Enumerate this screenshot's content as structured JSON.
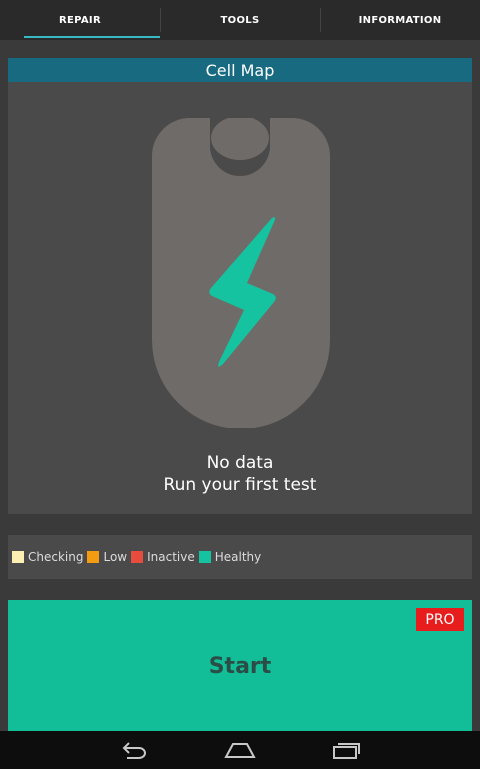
{
  "tabs": [
    {
      "label": "REPAIR",
      "active": true
    },
    {
      "label": "TOOLS",
      "active": false
    },
    {
      "label": "INFORMATION",
      "active": false
    }
  ],
  "cell_map": {
    "title": "Cell Map",
    "empty_line1": "No data",
    "empty_line2": "Run your first test",
    "icon": "battery-bolt-icon"
  },
  "legend": [
    {
      "label": "Checking",
      "color": "#fbefb2"
    },
    {
      "label": "Low",
      "color": "#f39c12"
    },
    {
      "label": "Inactive",
      "color": "#e74c3c"
    },
    {
      "label": "Healthy",
      "color": "#16c3a0"
    }
  ],
  "start_button": {
    "label": "Start",
    "badge": "PRO",
    "color": "#11be98"
  },
  "navbar": {
    "icons": [
      "back-icon",
      "home-icon",
      "recents-icon"
    ]
  }
}
